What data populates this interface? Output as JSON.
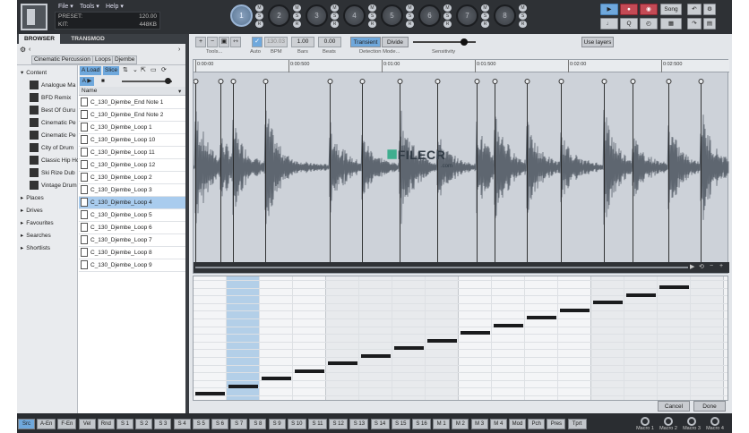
{
  "menu": {
    "file": "File ▾",
    "tools": "Tools ▾",
    "help": "Help ▾"
  },
  "preset": {
    "preset_label": "PRESET:",
    "preset_value": "120.00",
    "kit_label": "KIT:",
    "kit_value": "448KB"
  },
  "pads": [
    "1",
    "2",
    "3",
    "4",
    "5",
    "6",
    "7",
    "8"
  ],
  "msr": [
    "M",
    "S",
    "R"
  ],
  "transport": {
    "song": "Song",
    "q": "Q"
  },
  "browser": {
    "tabs": [
      "BROWSER",
      "TRANSMOD"
    ],
    "breadcrumb": [
      "Cinematic Percussion",
      "Loops",
      "Djembe"
    ],
    "load": "Load",
    "slice": "Slice",
    "name_header": "Name",
    "tree": [
      "Content",
      "Analogue Ma",
      "BFD Remix",
      "Best Of Guru",
      "Cinematic Pe",
      "Cinematic Pe",
      "City of Drum",
      "Classic Hip Ho",
      "Ski Rize Dub",
      "Vintage Drum",
      "Places",
      "Drives",
      "Favourites",
      "Searches",
      "Shortlists"
    ],
    "files": [
      "C_130_Djembe_End Note 1",
      "C_130_Djembe_End Note 2",
      "C_130_Djembe_Loop 1",
      "C_130_Djembe_Loop 10",
      "C_130_Djembe_Loop 11",
      "C_130_Djembe_Loop 12",
      "C_130_Djembe_Loop 2",
      "C_130_Djembe_Loop 3",
      "C_130_Djembe_Loop 4",
      "C_130_Djembe_Loop 5",
      "C_130_Djembe_Loop 6",
      "C_130_Djembe_Loop 7",
      "C_130_Djembe_Loop 8",
      "C_130_Djembe_Loop 9"
    ],
    "selected_file": "C_130_Djembe_Loop 4"
  },
  "slicer": {
    "tools_label": "Tools...",
    "auto_label": "Auto",
    "bpm_value": "130.03",
    "bpm_label": "BPM",
    "bars_value": "1.00",
    "bars_label": "Bars",
    "beats_value": "0.00",
    "beats_label": "Beats",
    "transient": "Transient",
    "divide": "Divide",
    "detection_label": "Detection Mode...",
    "sensitivity_label": "Sensitivity",
    "use_layers": "Use layers",
    "ruler": [
      "0:00:00",
      "0:00:500",
      "0:01:00",
      "0:01:500",
      "0:02:00",
      "0:02:500"
    ],
    "cancel": "Cancel",
    "done": "Done"
  },
  "watermark": {
    "main": "FILECR",
    "sub": ".com"
  },
  "bottom_tabs": [
    "Src",
    "A-En",
    "F-En",
    "Vel",
    "Rnd",
    "S 1",
    "S 2",
    "S 3",
    "S 4",
    "S 5",
    "S 6",
    "S 7",
    "S 8",
    "S 9",
    "S 10",
    "S 11",
    "S 12",
    "S 13",
    "S 14",
    "S 15",
    "S 16",
    "M 1",
    "M 2",
    "M 3",
    "M 4",
    "Mod",
    "Pch",
    "Pres",
    "Tprt"
  ],
  "macros": [
    "Macro 1",
    "Macro 2",
    "Macro 3",
    "Macro 4"
  ],
  "colors": {
    "accent": "#6fa8dc",
    "selected_row": "#a9ccee",
    "waveform": "#5e6670"
  }
}
